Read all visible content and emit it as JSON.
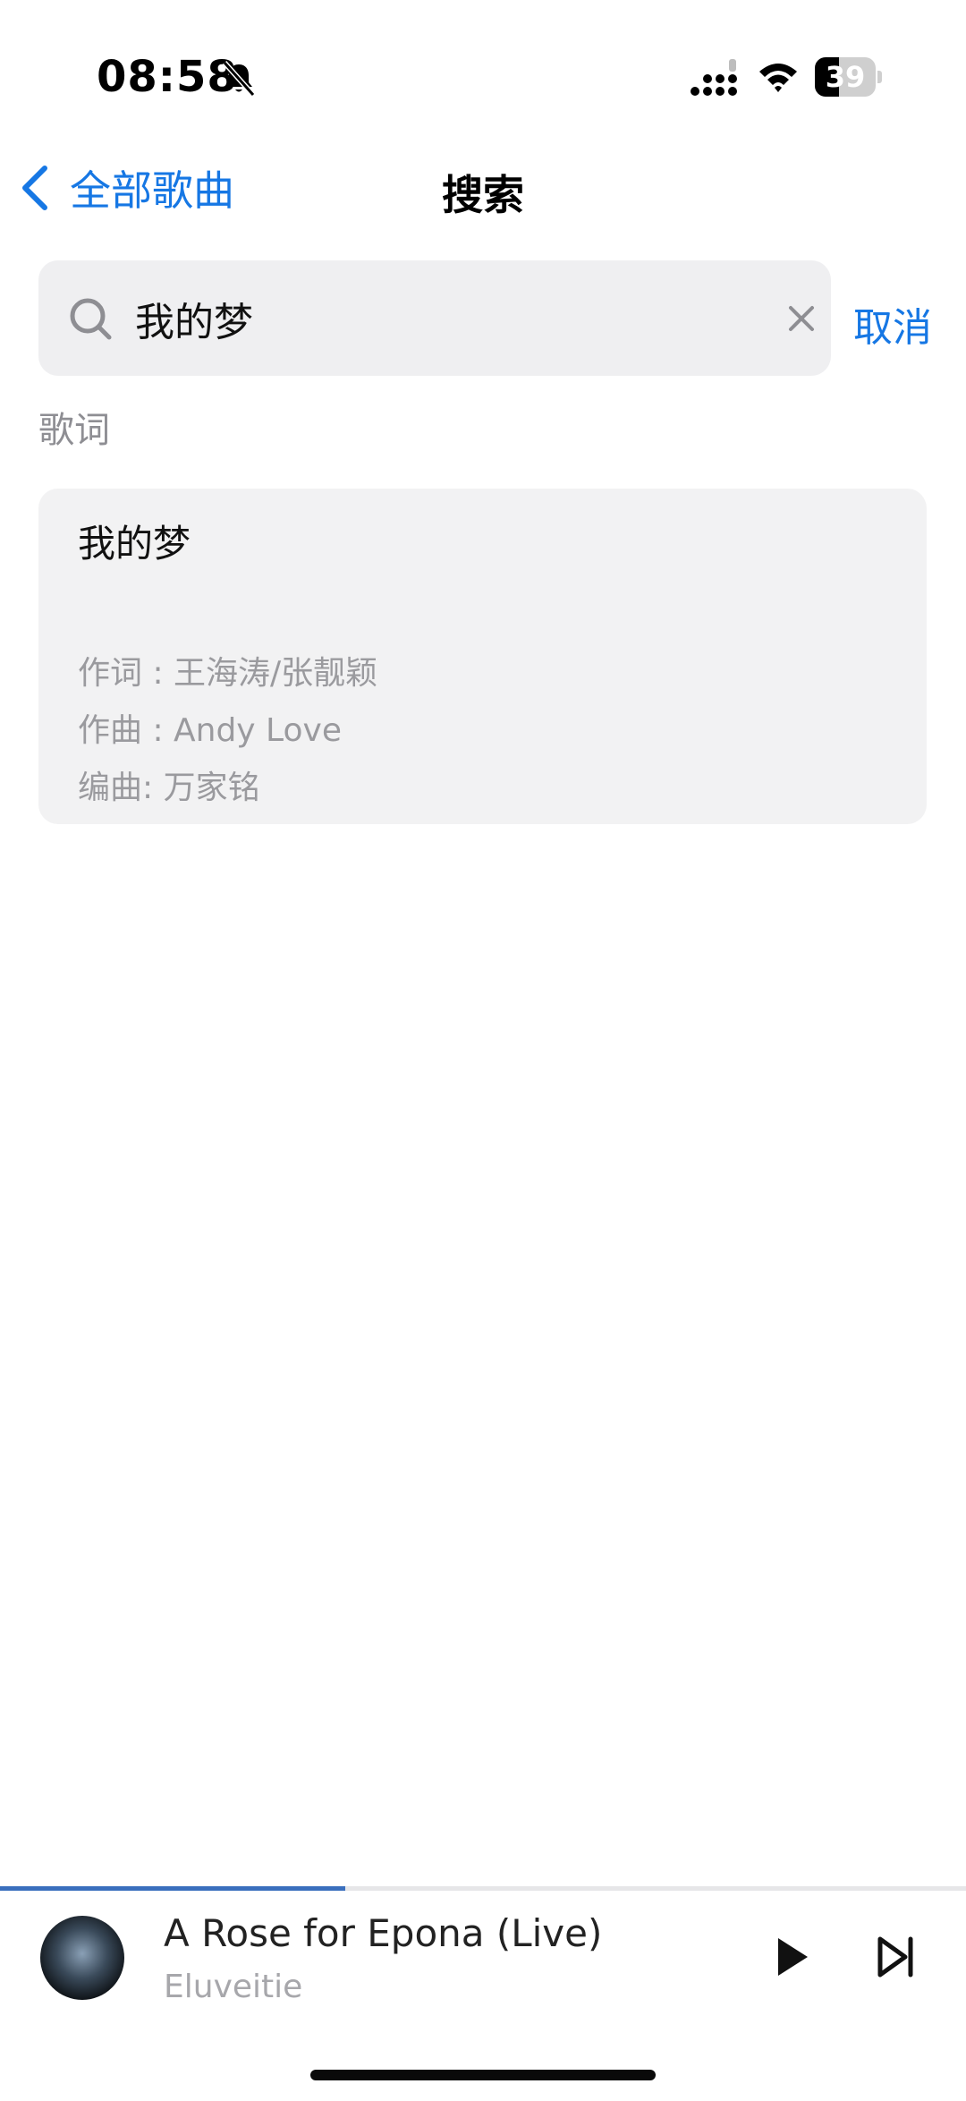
{
  "status_bar": {
    "time": "08:58",
    "battery": "39",
    "battery_level": 0.39,
    "icons": [
      "bell-slash-icon",
      "signal-icon",
      "wifi-icon",
      "battery-icon"
    ]
  },
  "nav": {
    "back_label": "全部歌曲",
    "title": "搜索"
  },
  "search": {
    "value": "我的梦",
    "placeholder": "",
    "cancel_label": "取消"
  },
  "results": {
    "section_label": "歌词",
    "items": [
      {
        "title": "我的梦",
        "lines": [
          "作词 : 王海涛/张靓颖",
          "作曲 : Andy Love",
          "编曲:  万家铭"
        ]
      }
    ]
  },
  "player": {
    "title": "A Rose for Epona (Live)",
    "artist": "Eluveitie",
    "progress": 0.357
  },
  "colors": {
    "accent": "#1677e4",
    "progress": "#3a6fbd",
    "search_bg": "#efeff1",
    "card_bg": "#f2f2f3",
    "secondary_text": "#9a9a9e"
  }
}
